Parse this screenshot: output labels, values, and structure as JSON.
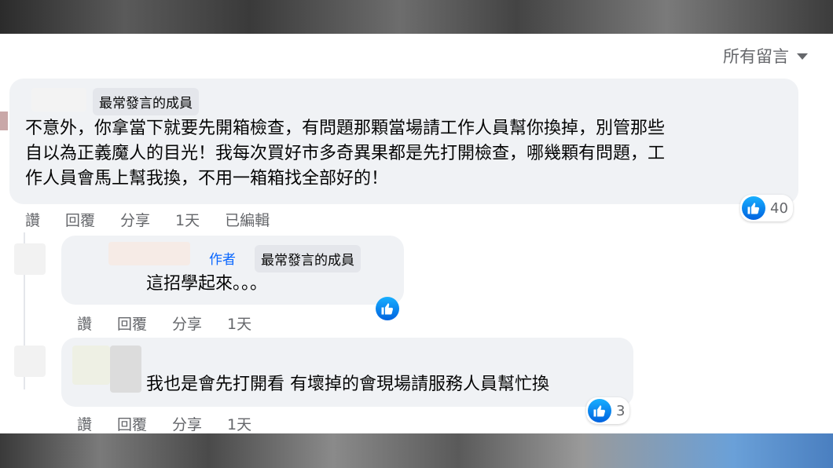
{
  "sort": {
    "label": "所有留言"
  },
  "comments": [
    {
      "badge": "最常發言的成員",
      "text": "不意外，你拿當下就要先開箱檢查，有問題那顆當場請工作人員幫你換掉，別管那些自以為正義魔人的目光！我每次買好市多奇異果都是先打開檢查，哪幾顆有問題，工作人員會馬上幫我換，不用一箱箱找全部好的！",
      "line1": "不意外，你拿當下就要先開箱檢查，有問題那顆當場請工作人員幫你換掉，別管那些",
      "line2": "自以為正義魔人的目光！我每次買好市多奇異果都是先打開檢查，哪幾顆有問題，工",
      "line3": "作人員會馬上幫我換，不用一箱箱找全部好的！",
      "like_count": "40",
      "actions": {
        "like": "讚",
        "reply": "回覆",
        "share": "分享",
        "time": "1天",
        "edited": "已編輯"
      }
    },
    {
      "author_tag": "作者",
      "badge": "最常發言的成員",
      "text": "這招學起來。。。",
      "actions": {
        "like": "讚",
        "reply": "回覆",
        "share": "分享",
        "time": "1天"
      }
    },
    {
      "text": "我也是會先打開看 有壞掉的會現場請服務人員幫忙換",
      "like_count": "3",
      "actions": {
        "like": "讚",
        "reply": "回覆",
        "share": "分享",
        "time": "1天"
      }
    }
  ],
  "colors": {
    "like_blue": "#0866ff",
    "bubble_bg": "#f0f2f5",
    "meta_gray": "#65676b"
  }
}
